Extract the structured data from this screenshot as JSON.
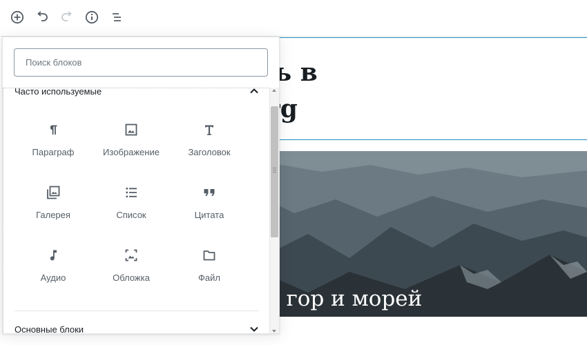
{
  "toolbar": {
    "add_icon": "plus-circle-icon",
    "undo_icon": "undo-icon",
    "redo_icon": "redo-icon",
    "info_icon": "info-icon",
    "navigation_icon": "list-view-icon"
  },
  "editor": {
    "title": "ро пожаловать в\nктор Gutenberg",
    "cover_title": "Книга гор и морей"
  },
  "inserter": {
    "search_placeholder": "Поиск блоков",
    "panels": [
      {
        "title": "Часто используемые",
        "expanded": true,
        "items": [
          {
            "label": "Параграф",
            "icon": "paragraph-icon"
          },
          {
            "label": "Изображение",
            "icon": "image-icon"
          },
          {
            "label": "Заголовок",
            "icon": "heading-icon"
          },
          {
            "label": "Галерея",
            "icon": "gallery-icon"
          },
          {
            "label": "Список",
            "icon": "list-icon"
          },
          {
            "label": "Цитата",
            "icon": "quote-icon"
          },
          {
            "label": "Аудио",
            "icon": "audio-icon"
          },
          {
            "label": "Обложка",
            "icon": "cover-icon"
          },
          {
            "label": "Файл",
            "icon": "file-icon"
          }
        ]
      },
      {
        "title": "Основные блоки",
        "expanded": false
      }
    ]
  },
  "colors": {
    "accent": "#1e8cbe",
    "text": "#191e23",
    "muted": "#555d66"
  }
}
